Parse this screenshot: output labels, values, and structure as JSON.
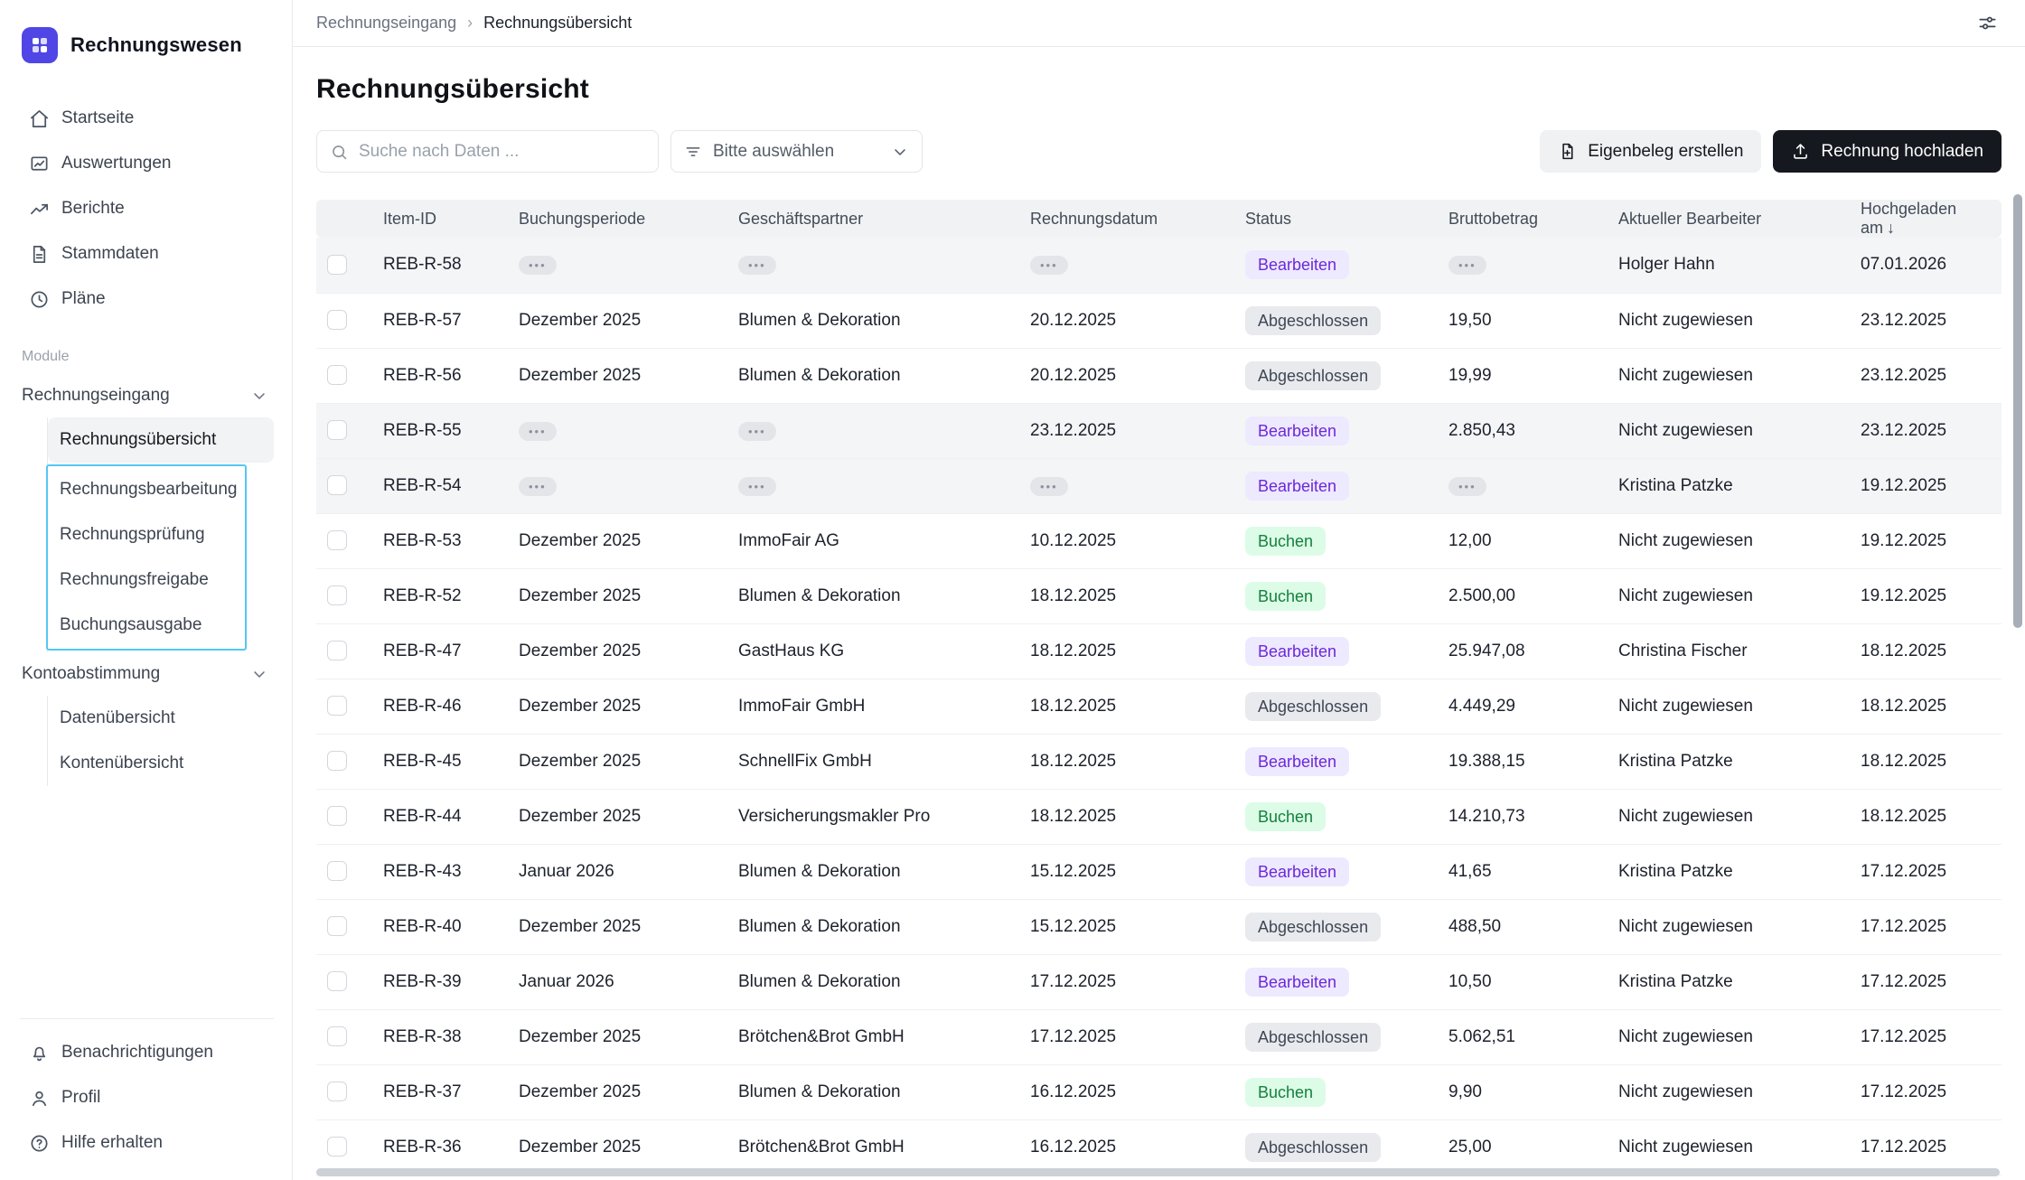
{
  "colors": {
    "brand": "#4F46E5",
    "primary_button_bg": "#15181E",
    "highlight_box": "#55C7F2",
    "badge_violet_bg": "#EDE9FE",
    "badge_violet_text": "#6D28D9",
    "badge_gray_bg": "#E8EAEE",
    "badge_gray_text": "#3F4754",
    "badge_green_bg": "#DCFCE7",
    "badge_green_text": "#15803D"
  },
  "app": {
    "name": "Rechnungswesen"
  },
  "sidebar": {
    "nav": [
      {
        "label": "Startseite",
        "icon": "home-icon"
      },
      {
        "label": "Auswertungen",
        "icon": "chart-icon"
      },
      {
        "label": "Berichte",
        "icon": "trending-icon"
      },
      {
        "label": "Stammdaten",
        "icon": "document-icon"
      },
      {
        "label": "Pläne",
        "icon": "clock-icon"
      }
    ],
    "section_label": "Module",
    "groups": [
      {
        "label": "Rechnungseingang",
        "items": [
          {
            "label": "Rechnungsübersicht",
            "active": true
          },
          {
            "label": "Rechnungsbearbeitung"
          },
          {
            "label": "Rechnungsprüfung"
          },
          {
            "label": "Rechnungsfreigabe"
          },
          {
            "label": "Buchungsausgabe"
          }
        ]
      },
      {
        "label": "Kontoabstimmung",
        "items": [
          {
            "label": "Datenübersicht"
          },
          {
            "label": "Kontenübersicht"
          }
        ]
      }
    ],
    "footer": [
      {
        "label": "Benachrichtigungen",
        "icon": "bell-icon"
      },
      {
        "label": "Profil",
        "icon": "user-icon"
      },
      {
        "label": "Hilfe erhalten",
        "icon": "help-icon"
      }
    ]
  },
  "breadcrumb": {
    "parent": "Rechnungseingang",
    "separator": "›",
    "current": "Rechnungsübersicht"
  },
  "page": {
    "title": "Rechnungsübersicht"
  },
  "toolbar": {
    "search_placeholder": "Suche nach Daten ...",
    "filter_select_label": "Bitte auswählen",
    "create_receipt_button": "Eigenbeleg erstellen",
    "upload_invoice_button": "Rechnung hochladen"
  },
  "table": {
    "placeholder": "•••",
    "sort_arrow": "↓",
    "columns": [
      "Item-ID",
      "Buchungsperiode",
      "Geschäftspartner",
      "Rechnungsdatum",
      "Status",
      "Bruttobetrag",
      "Aktueller Bearbeiter",
      "Hochgeladen am"
    ],
    "status_styles": {
      "Bearbeiten": "violet",
      "Abgeschlossen": "gray",
      "Buchen": "green"
    },
    "rows": [
      {
        "item_id": "REB-R-58",
        "buchungsperiode": "•••",
        "geschaeftspartner": "•••",
        "rechnungsdatum": "•••",
        "status": "Bearbeiten",
        "bruttobetrag": "•••",
        "bearbeiter": "Holger Hahn",
        "hochgeladen_am": "07.01.2026",
        "pending": true
      },
      {
        "item_id": "REB-R-57",
        "buchungsperiode": "Dezember 2025",
        "geschaeftspartner": "Blumen & Dekoration",
        "rechnungsdatum": "20.12.2025",
        "status": "Abgeschlossen",
        "bruttobetrag": "19,50",
        "bearbeiter": "Nicht zugewiesen",
        "hochgeladen_am": "23.12.2025"
      },
      {
        "item_id": "REB-R-56",
        "buchungsperiode": "Dezember 2025",
        "geschaeftspartner": "Blumen & Dekoration",
        "rechnungsdatum": "20.12.2025",
        "status": "Abgeschlossen",
        "bruttobetrag": "19,99",
        "bearbeiter": "Nicht zugewiesen",
        "hochgeladen_am": "23.12.2025"
      },
      {
        "item_id": "REB-R-55",
        "buchungsperiode": "•••",
        "geschaeftspartner": "•••",
        "rechnungsdatum": "23.12.2025",
        "status": "Bearbeiten",
        "bruttobetrag": "2.850,43",
        "bearbeiter": "Nicht zugewiesen",
        "hochgeladen_am": "23.12.2025",
        "pending": true
      },
      {
        "item_id": "REB-R-54",
        "buchungsperiode": "•••",
        "geschaeftspartner": "•••",
        "rechnungsdatum": "•••",
        "status": "Bearbeiten",
        "bruttobetrag": "•••",
        "bearbeiter": "Kristina Patzke",
        "hochgeladen_am": "19.12.2025",
        "pending": true
      },
      {
        "item_id": "REB-R-53",
        "buchungsperiode": "Dezember 2025",
        "geschaeftspartner": "ImmoFair AG",
        "rechnungsdatum": "10.12.2025",
        "status": "Buchen",
        "bruttobetrag": "12,00",
        "bearbeiter": "Nicht zugewiesen",
        "hochgeladen_am": "19.12.2025"
      },
      {
        "item_id": "REB-R-52",
        "buchungsperiode": "Dezember 2025",
        "geschaeftspartner": "Blumen & Dekoration",
        "rechnungsdatum": "18.12.2025",
        "status": "Buchen",
        "bruttobetrag": "2.500,00",
        "bearbeiter": "Nicht zugewiesen",
        "hochgeladen_am": "19.12.2025"
      },
      {
        "item_id": "REB-R-47",
        "buchungsperiode": "Dezember 2025",
        "geschaeftspartner": "GastHaus KG",
        "rechnungsdatum": "18.12.2025",
        "status": "Bearbeiten",
        "bruttobetrag": "25.947,08",
        "bearbeiter": "Christina Fischer",
        "hochgeladen_am": "18.12.2025"
      },
      {
        "item_id": "REB-R-46",
        "buchungsperiode": "Dezember 2025",
        "geschaeftspartner": "ImmoFair GmbH",
        "rechnungsdatum": "18.12.2025",
        "status": "Abgeschlossen",
        "bruttobetrag": "4.449,29",
        "bearbeiter": "Nicht zugewiesen",
        "hochgeladen_am": "18.12.2025"
      },
      {
        "item_id": "REB-R-45",
        "buchungsperiode": "Dezember 2025",
        "geschaeftspartner": "SchnellFix GmbH",
        "rechnungsdatum": "18.12.2025",
        "status": "Bearbeiten",
        "bruttobetrag": "19.388,15",
        "bearbeiter": "Kristina Patzke",
        "hochgeladen_am": "18.12.2025"
      },
      {
        "item_id": "REB-R-44",
        "buchungsperiode": "Dezember 2025",
        "geschaeftspartner": "Versicherungsmakler Pro",
        "rechnungsdatum": "18.12.2025",
        "status": "Buchen",
        "bruttobetrag": "14.210,73",
        "bearbeiter": "Nicht zugewiesen",
        "hochgeladen_am": "18.12.2025"
      },
      {
        "item_id": "REB-R-43",
        "buchungsperiode": "Januar 2026",
        "geschaeftspartner": "Blumen & Dekoration",
        "rechnungsdatum": "15.12.2025",
        "status": "Bearbeiten",
        "bruttobetrag": "41,65",
        "bearbeiter": "Kristina Patzke",
        "hochgeladen_am": "17.12.2025"
      },
      {
        "item_id": "REB-R-40",
        "buchungsperiode": "Dezember 2025",
        "geschaeftspartner": "Blumen & Dekoration",
        "rechnungsdatum": "15.12.2025",
        "status": "Abgeschlossen",
        "bruttobetrag": "488,50",
        "bearbeiter": "Nicht zugewiesen",
        "hochgeladen_am": "17.12.2025"
      },
      {
        "item_id": "REB-R-39",
        "buchungsperiode": "Januar 2026",
        "geschaeftspartner": "Blumen & Dekoration",
        "rechnungsdatum": "17.12.2025",
        "status": "Bearbeiten",
        "bruttobetrag": "10,50",
        "bearbeiter": "Kristina Patzke",
        "hochgeladen_am": "17.12.2025"
      },
      {
        "item_id": "REB-R-38",
        "buchungsperiode": "Dezember 2025",
        "geschaeftspartner": "Brötchen&Brot GmbH",
        "rechnungsdatum": "17.12.2025",
        "status": "Abgeschlossen",
        "bruttobetrag": "5.062,51",
        "bearbeiter": "Nicht zugewiesen",
        "hochgeladen_am": "17.12.2025"
      },
      {
        "item_id": "REB-R-37",
        "buchungsperiode": "Dezember 2025",
        "geschaeftspartner": "Blumen & Dekoration",
        "rechnungsdatum": "16.12.2025",
        "status": "Buchen",
        "bruttobetrag": "9,90",
        "bearbeiter": "Nicht zugewiesen",
        "hochgeladen_am": "17.12.2025"
      },
      {
        "item_id": "REB-R-36",
        "buchungsperiode": "Dezember 2025",
        "geschaeftspartner": "Brötchen&Brot GmbH",
        "rechnungsdatum": "16.12.2025",
        "status": "Abgeschlossen",
        "bruttobetrag": "25,00",
        "bearbeiter": "Nicht zugewiesen",
        "hochgeladen_am": "17.12.2025"
      }
    ]
  }
}
